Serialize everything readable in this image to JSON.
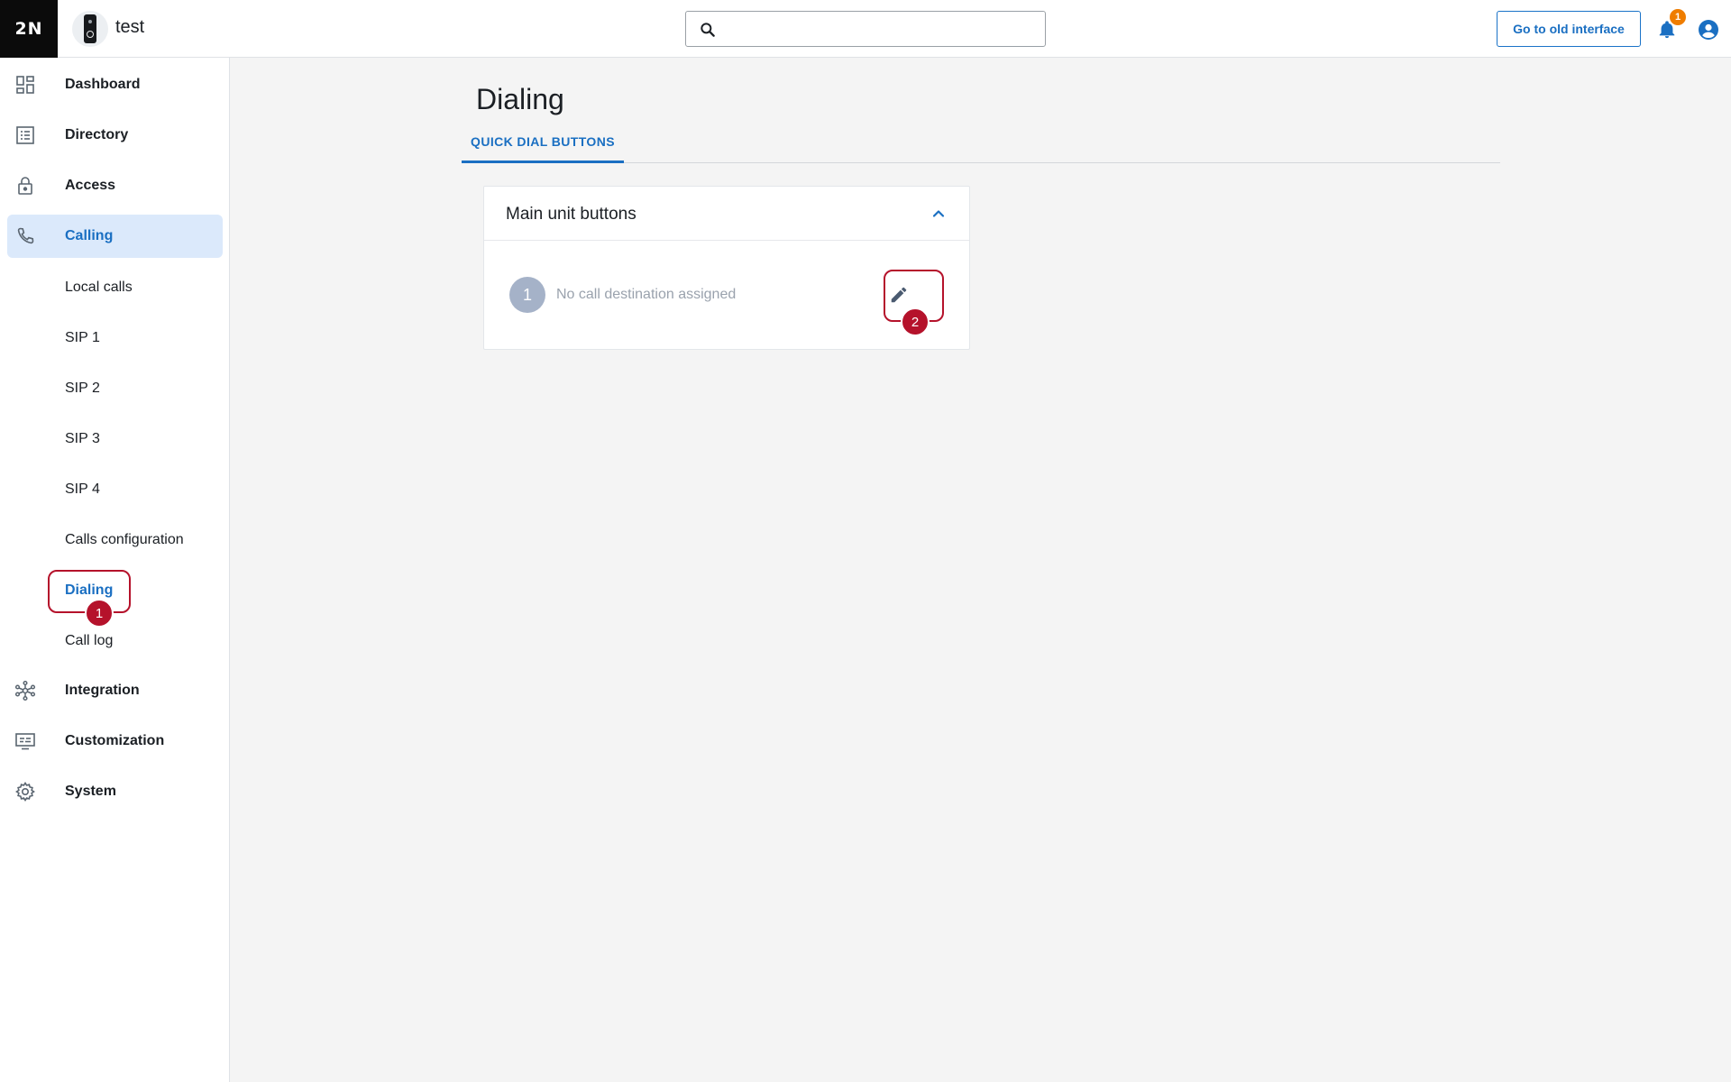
{
  "topbar": {
    "logo_text": "2N",
    "device_name": "test",
    "search": {
      "value": "",
      "placeholder": ""
    },
    "old_interface_label": "Go to old interface",
    "notification_count": "1"
  },
  "sidebar": {
    "items": [
      {
        "label": "Dashboard",
        "icon": "dashboard-icon"
      },
      {
        "label": "Directory",
        "icon": "directory-icon"
      },
      {
        "label": "Access",
        "icon": "lock-icon"
      },
      {
        "label": "Calling",
        "icon": "phone-icon",
        "active": true
      },
      {
        "label": "Integration",
        "icon": "network-icon"
      },
      {
        "label": "Customization",
        "icon": "display-icon"
      },
      {
        "label": "System",
        "icon": "gear-icon"
      }
    ],
    "calling_sub": [
      "Local calls",
      "SIP 1",
      "SIP 2",
      "SIP 3",
      "SIP 4",
      "Calls configuration",
      "Dialing",
      "Call log"
    ],
    "active_sub": "Dialing"
  },
  "main": {
    "title": "Dialing",
    "tabs": [
      {
        "label": "QUICK DIAL BUTTONS",
        "active": true
      }
    ],
    "card": {
      "title": "Main unit buttons",
      "rows": [
        {
          "number": "1",
          "text": "No call destination assigned"
        }
      ]
    }
  },
  "callouts": [
    "1",
    "2"
  ],
  "colors": {
    "accent": "#1a6fc2",
    "active_bg": "#dbe9fb",
    "callout": "#b5122b",
    "badge": "#ef7d00"
  }
}
